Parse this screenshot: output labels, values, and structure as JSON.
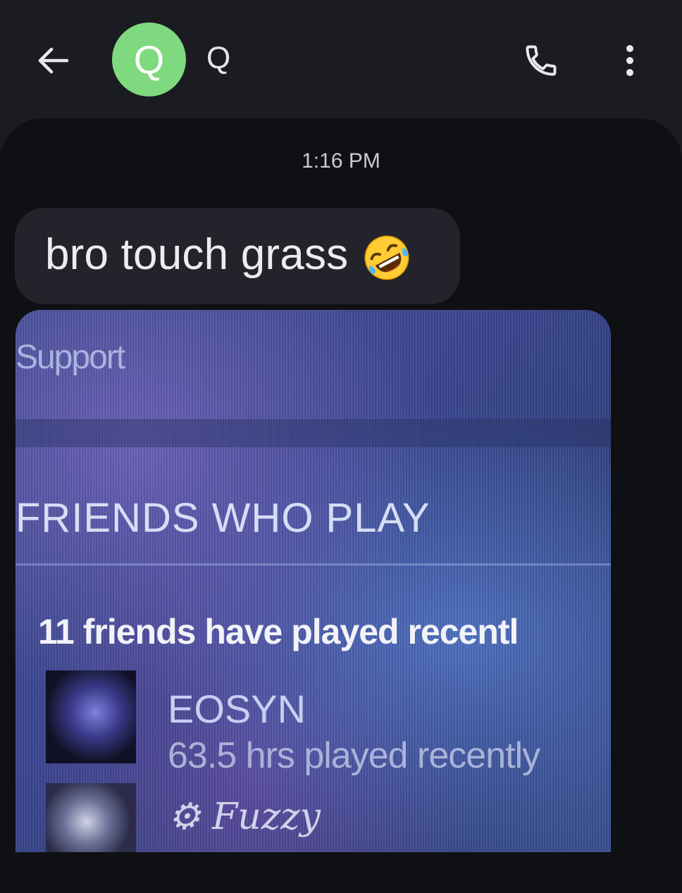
{
  "header": {
    "avatar_initial": "Q",
    "contact_name": "Q",
    "colors": {
      "avatar_bg": "#7fd97e",
      "background": "#1b1c22"
    },
    "icons": [
      "back-arrow-icon",
      "phone-icon",
      "more-vert-icon"
    ]
  },
  "thread": {
    "timestamp": "1:16 PM",
    "messages": [
      {
        "text": "bro touch grass",
        "emoji": "rolling-on-floor-laughing-emoji"
      }
    ],
    "attachment": {
      "support_text": "Support",
      "heading": "FRIENDS WHO PLAY",
      "friends_count_text": "11 friends have played recentl",
      "friends": [
        {
          "name": "EOSYN",
          "played": "63.5 hrs played recently"
        },
        {
          "name": "⚙ Fuzzy",
          "played": ""
        }
      ]
    }
  }
}
